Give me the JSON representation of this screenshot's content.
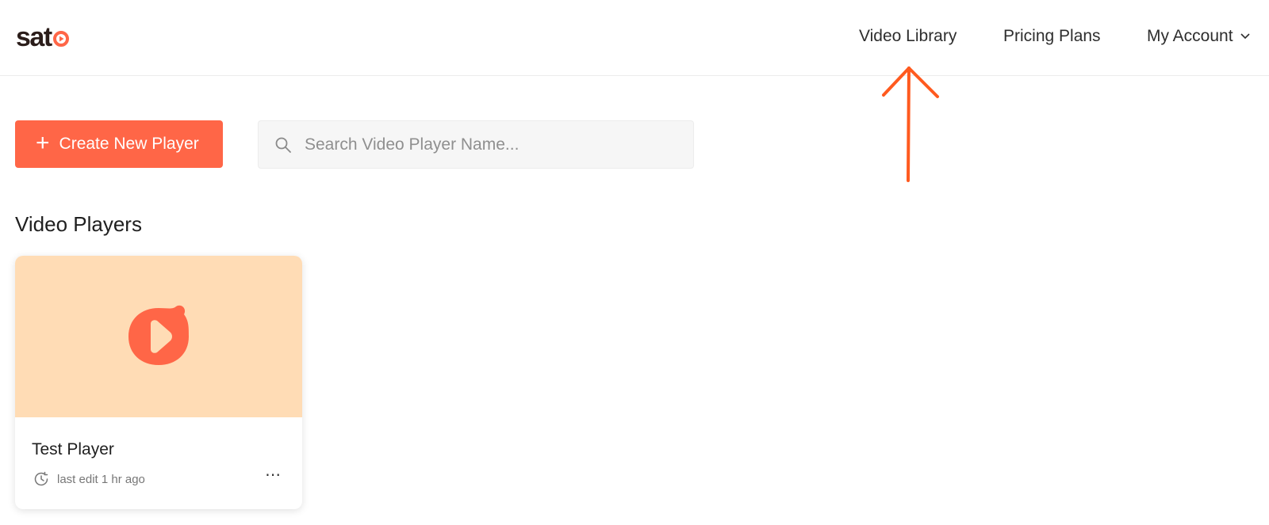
{
  "brand": {
    "logo_text": "sat",
    "logo_o": "o",
    "accent_color": "#ff6647"
  },
  "nav": {
    "video_library": "Video Library",
    "pricing_plans": "Pricing Plans",
    "my_account": "My Account"
  },
  "toolbar": {
    "create_label": "Create New Player",
    "create_icon": "plus-icon",
    "search_placeholder": "Search Video Player Name...",
    "search_value": ""
  },
  "section": {
    "title": "Video Players"
  },
  "players": [
    {
      "name": "Test Player",
      "meta": "last edit 1 hr ago",
      "thumb_bg": "#ffdcb5"
    }
  ]
}
